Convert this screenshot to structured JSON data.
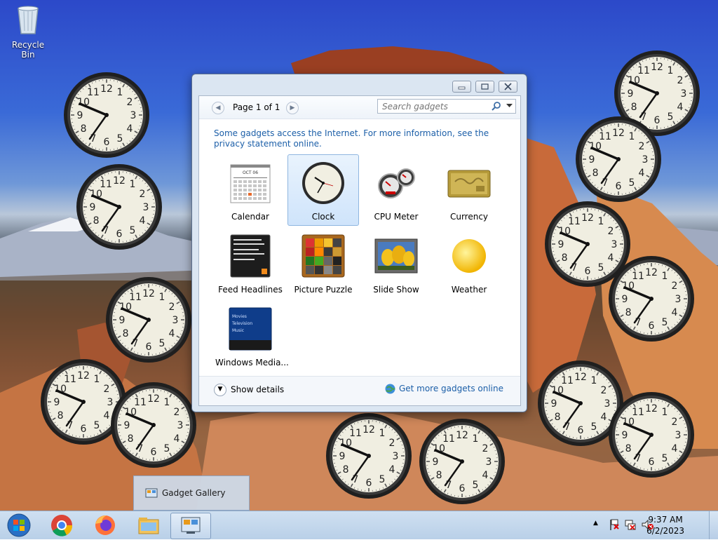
{
  "desktop": {
    "recycle_bin_label": "Recycle Bin",
    "clock_gadget_count": 13
  },
  "gallery": {
    "title": "Gadget Gallery",
    "page_label": "Page 1 of 1",
    "search_placeholder": "Search gadgets",
    "info_text": "Some gadgets access the Internet.  For more information, see the privacy statement online.",
    "gadgets": [
      {
        "label": "Calendar",
        "icon": "calendar-icon",
        "selected": false
      },
      {
        "label": "Clock",
        "icon": "clock-icon",
        "selected": true
      },
      {
        "label": "CPU Meter",
        "icon": "cpu-meter-icon",
        "selected": false
      },
      {
        "label": "Currency",
        "icon": "currency-icon",
        "selected": false
      },
      {
        "label": "Feed Headlines",
        "icon": "feed-headlines-icon",
        "selected": false
      },
      {
        "label": "Picture Puzzle",
        "icon": "picture-puzzle-icon",
        "selected": false
      },
      {
        "label": "Slide Show",
        "icon": "slide-show-icon",
        "selected": false
      },
      {
        "label": "Weather",
        "icon": "weather-icon",
        "selected": false
      },
      {
        "label": "Windows Media...",
        "icon": "windows-media-icon",
        "selected": false
      }
    ],
    "calendar_month": "OCT 06",
    "media_lines": [
      "Movies",
      "Television",
      "Music"
    ],
    "show_details": "Show details",
    "get_more_link": "Get more gadgets online"
  },
  "taskbar": {
    "pinned": [
      "start-button",
      "chrome-icon",
      "firefox-icon",
      "file-explorer-icon",
      "gadget-gallery-icon"
    ],
    "thumbnail_label": "Gadget Gallery",
    "time": "9:37 AM",
    "date": "6/2/2023"
  },
  "colors": {
    "link": "#1c5fa8",
    "taskbar": "#c4d8ee",
    "selection": "#cfe4fb"
  }
}
